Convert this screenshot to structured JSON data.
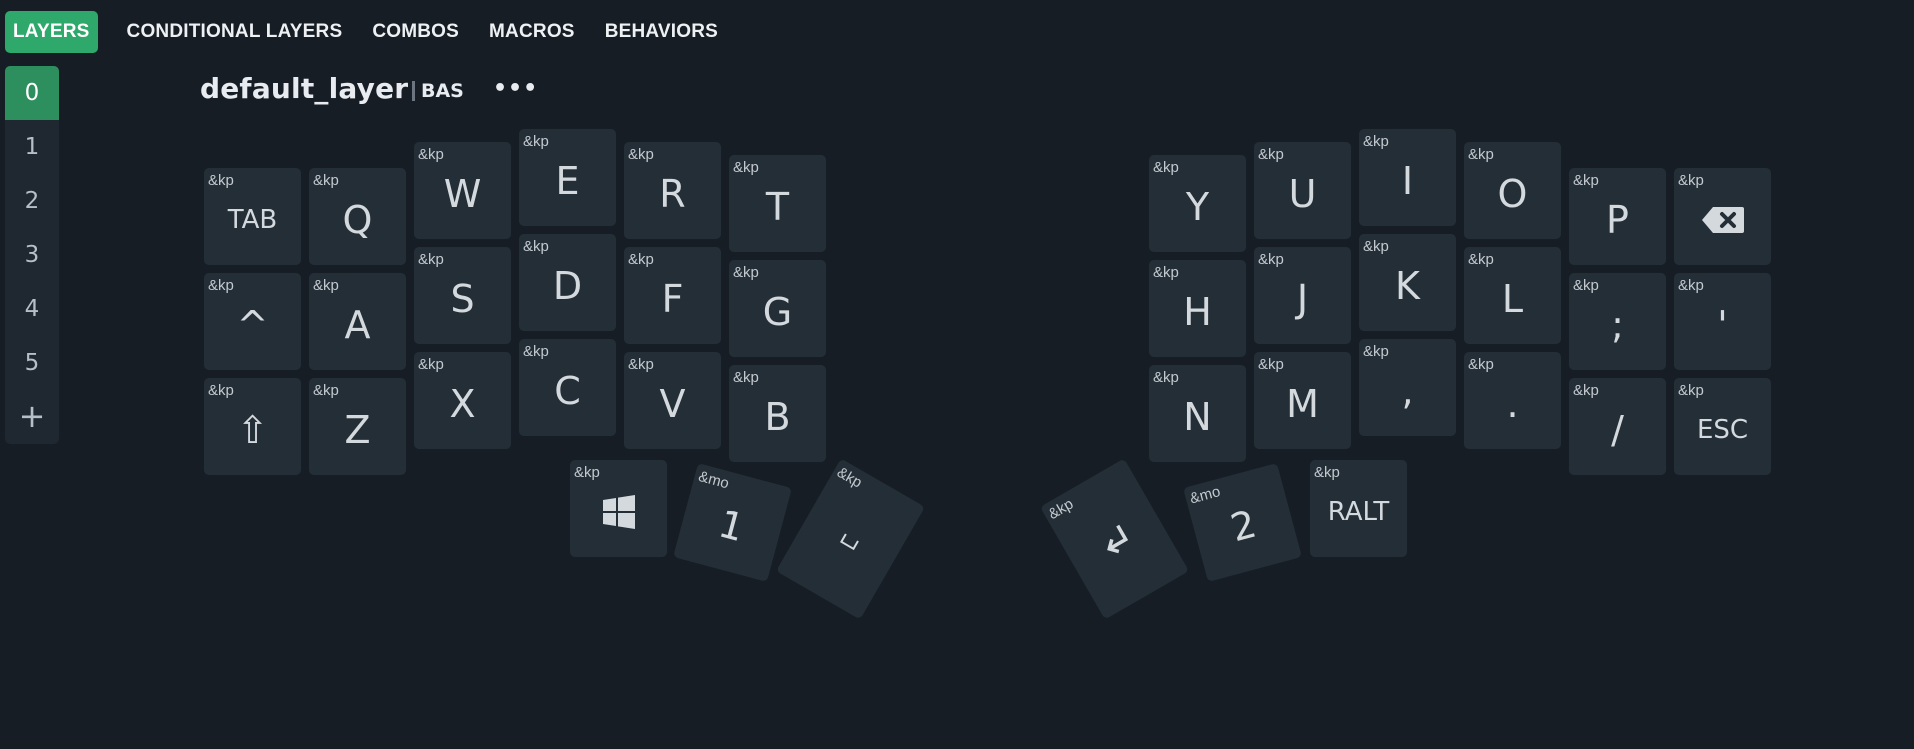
{
  "nav": {
    "tabs": [
      "LAYERS",
      "CONDITIONAL LAYERS",
      "COMBOS",
      "MACROS",
      "BEHAVIORS"
    ]
  },
  "layers": {
    "items": [
      "0",
      "1",
      "2",
      "3",
      "4",
      "5"
    ],
    "add_label": "+"
  },
  "layer_header": {
    "name": "default_layer",
    "abbreviation": "BAS",
    "menu_label": "•••"
  },
  "keys": {
    "left_top": [
      {
        "behavior": "&kp",
        "label": "TAB"
      },
      {
        "behavior": "&kp",
        "label": "Q"
      },
      {
        "behavior": "&kp",
        "label": "W"
      },
      {
        "behavior": "&kp",
        "label": "E"
      },
      {
        "behavior": "&kp",
        "label": "R"
      },
      {
        "behavior": "&kp",
        "label": "T"
      }
    ],
    "left_home": [
      {
        "behavior": "&kp",
        "label": "^"
      },
      {
        "behavior": "&kp",
        "label": "A"
      },
      {
        "behavior": "&kp",
        "label": "S"
      },
      {
        "behavior": "&kp",
        "label": "D"
      },
      {
        "behavior": "&kp",
        "label": "F"
      },
      {
        "behavior": "&kp",
        "label": "G"
      }
    ],
    "left_bottom": [
      {
        "behavior": "&kp",
        "label": "⇧"
      },
      {
        "behavior": "&kp",
        "label": "Z"
      },
      {
        "behavior": "&kp",
        "label": "X"
      },
      {
        "behavior": "&kp",
        "label": "C"
      },
      {
        "behavior": "&kp",
        "label": "V"
      },
      {
        "behavior": "&kp",
        "label": "B"
      }
    ],
    "right_top": [
      {
        "behavior": "&kp",
        "label": "Y"
      },
      {
        "behavior": "&kp",
        "label": "U"
      },
      {
        "behavior": "&kp",
        "label": "I"
      },
      {
        "behavior": "&kp",
        "label": "O"
      },
      {
        "behavior": "&kp",
        "label": "P"
      },
      {
        "behavior": "&kp",
        "label": "",
        "icon": "backspace-icon"
      }
    ],
    "right_home": [
      {
        "behavior": "&kp",
        "label": "H"
      },
      {
        "behavior": "&kp",
        "label": "J"
      },
      {
        "behavior": "&kp",
        "label": "K"
      },
      {
        "behavior": "&kp",
        "label": "L"
      },
      {
        "behavior": "&kp",
        "label": ";"
      },
      {
        "behavior": "&kp",
        "label": "'"
      }
    ],
    "right_bottom": [
      {
        "behavior": "&kp",
        "label": "N"
      },
      {
        "behavior": "&kp",
        "label": "M"
      },
      {
        "behavior": "&kp",
        "label": ","
      },
      {
        "behavior": "&kp",
        "label": "."
      },
      {
        "behavior": "&kp",
        "label": "/"
      },
      {
        "behavior": "&kp",
        "label": "ESC"
      }
    ],
    "left_thumbs": [
      {
        "behavior": "&kp",
        "label": "",
        "icon": "windows-icon"
      },
      {
        "behavior": "&mo",
        "label": "1"
      },
      {
        "behavior": "&kp",
        "label": "␣",
        "icon": "space-icon"
      }
    ],
    "right_thumbs": [
      {
        "behavior": "&kp",
        "label": "↵",
        "icon": "enter-icon"
      },
      {
        "behavior": "&mo",
        "label": "2"
      },
      {
        "behavior": "&kp",
        "label": "RALT"
      }
    ]
  },
  "colors": {
    "background": "#171d25",
    "key": "#242e37",
    "accent": "#2fa86b"
  }
}
